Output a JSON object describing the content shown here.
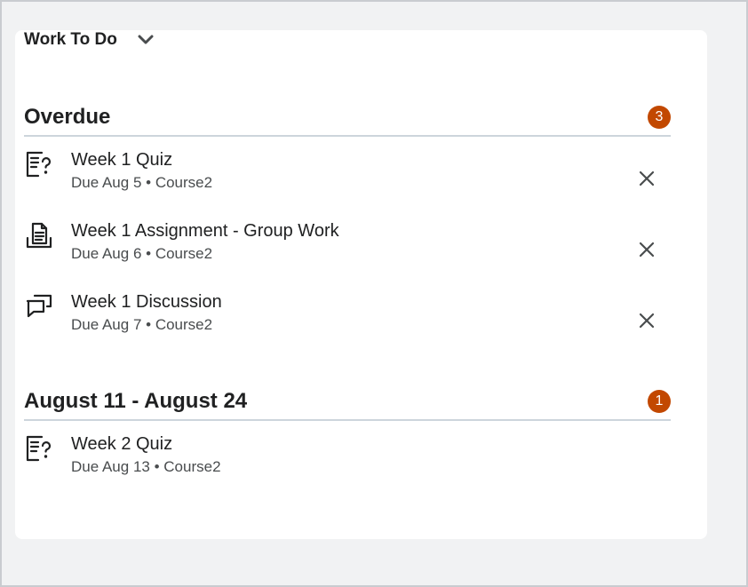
{
  "widget": {
    "title": "Work To Do"
  },
  "sections": [
    {
      "title": "Overdue",
      "count": "3",
      "items": [
        {
          "title": "Week 1 Quiz",
          "due": "Due Aug 5",
          "separator": "•",
          "course": "Course2",
          "icon": "quiz-icon",
          "dismissible": true
        },
        {
          "title": "Week 1 Assignment - Group Work",
          "due": "Due Aug 6",
          "separator": "•",
          "course": "Course2",
          "icon": "assignment-icon",
          "dismissible": true
        },
        {
          "title": "Week 1 Discussion",
          "due": "Due Aug 7",
          "separator": "•",
          "course": "Course2",
          "icon": "discussion-icon",
          "dismissible": true
        }
      ]
    },
    {
      "title": "August 11 - August 24",
      "count": "1",
      "items": [
        {
          "title": "Week 2 Quiz",
          "due": "Due Aug 13",
          "separator": "•",
          "course": "Course2",
          "icon": "quiz-icon",
          "dismissible": false
        }
      ]
    }
  ],
  "colors": {
    "badge": "#c24800",
    "divider": "#cdd5dc",
    "text": "#202122",
    "muted": "#494c4e"
  }
}
